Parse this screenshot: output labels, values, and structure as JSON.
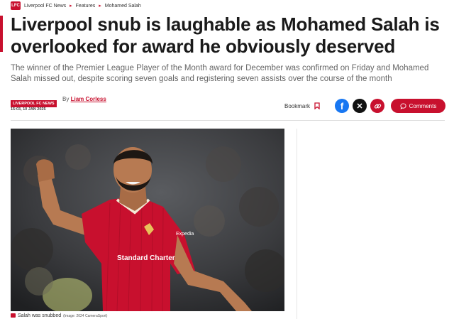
{
  "breadcrumb": {
    "logo_text": "LFC",
    "items": [
      "Liverpool FC News",
      "Features",
      "Mohamed Salah"
    ]
  },
  "article": {
    "title": "Liverpool snub is laughable as Mohamed Salah is overlooked for award he obviously deserved",
    "standfirst": "The winner of the Premier League Player of the Month award for December was confirmed on Friday and Mohamed Salah missed out, despite scoring seven goals and registering seven assists over the course of the month",
    "category": "LIVERPOOL FC NEWS",
    "by": "By",
    "author": "Liam Corless",
    "date": "15:03, 10 JAN 2025"
  },
  "actions": {
    "bookmark_label": "Bookmark",
    "comments_label": "Comments",
    "icons": [
      "facebook-icon",
      "x-icon",
      "link-icon",
      "comment-icon",
      "bookmark-icon"
    ]
  },
  "image": {
    "shirt_sponsor": "Standard Chartered",
    "shirt_sleeve": "Expedia",
    "caption": "Salah was snubbed",
    "credit": "(Image: 2024 CameraSport)"
  },
  "colors": {
    "accent": "#c8102e",
    "facebook": "#1877f2",
    "x": "#111111",
    "standfirst_text": "#666666"
  }
}
